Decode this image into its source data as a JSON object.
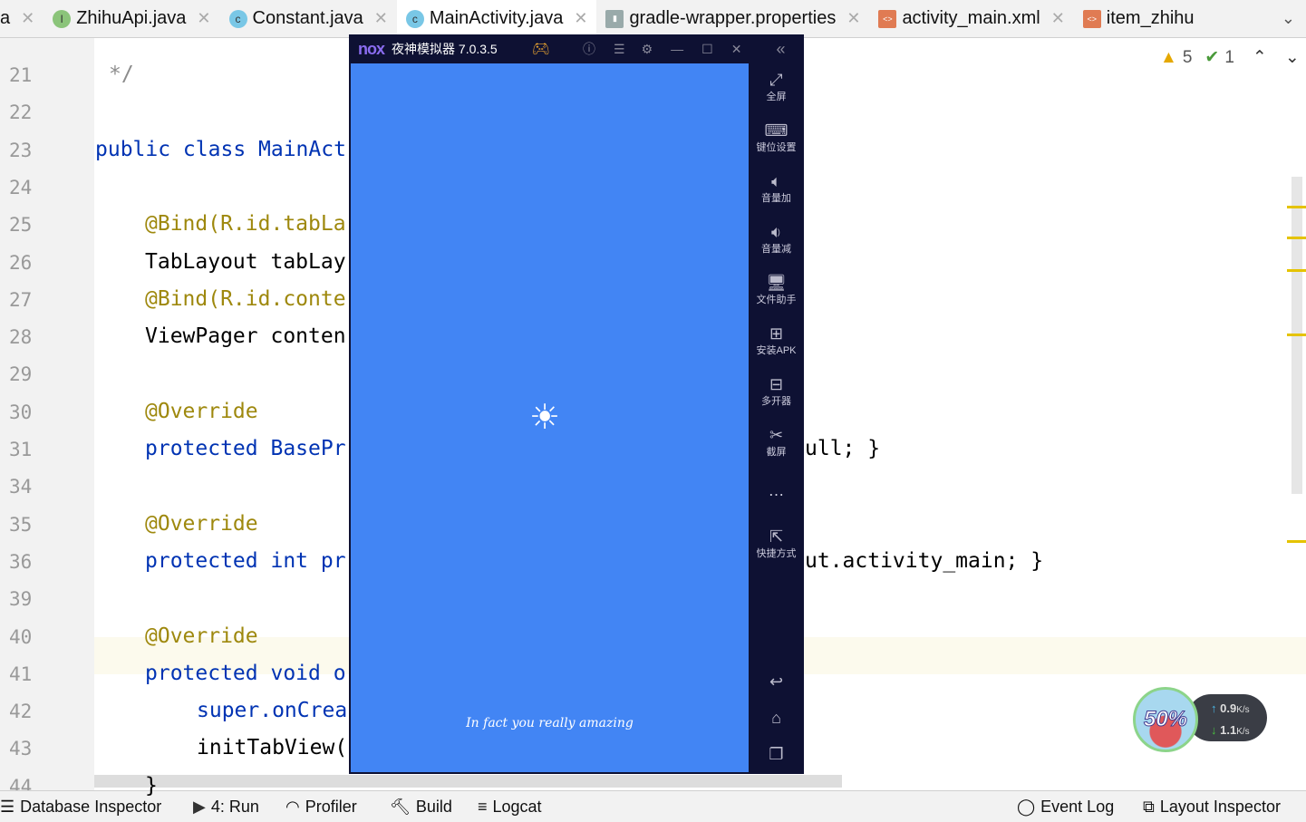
{
  "tabs": [
    {
      "label": "a",
      "icon": "none"
    },
    {
      "label": "ZhihuApi.java",
      "icon": "interface-icon"
    },
    {
      "label": "Constant.java",
      "icon": "class-icon"
    },
    {
      "label": "MainActivity.java",
      "icon": "class-icon",
      "active": true
    },
    {
      "label": "gradle-wrapper.properties",
      "icon": "properties-icon"
    },
    {
      "label": "activity_main.xml",
      "icon": "xml-icon"
    },
    {
      "label": "item_zhihu",
      "icon": "xml-icon"
    }
  ],
  "inspections": {
    "warnings": "5",
    "ok": "1"
  },
  "lines": [
    {
      "n": "21",
      "left": "*/"
    },
    {
      "n": "22",
      "left": ""
    },
    {
      "n": "23",
      "left": "public class MainAct"
    },
    {
      "n": "24",
      "left": ""
    },
    {
      "n": "25",
      "left": "@Bind(R.id.tabLa"
    },
    {
      "n": "26",
      "left": "TabLayout tabLay"
    },
    {
      "n": "27",
      "left": "@Bind(R.id.conte"
    },
    {
      "n": "28",
      "left": "ViewPager conten"
    },
    {
      "n": "29",
      "left": ""
    },
    {
      "n": "30",
      "left": "@Override"
    },
    {
      "n": "31",
      "left": "protected BasePr",
      "right": "ull; }"
    },
    {
      "n": "34",
      "left": ""
    },
    {
      "n": "35",
      "left": "@Override"
    },
    {
      "n": "36",
      "left": "protected int pr",
      "right": "ut.activity_main; }"
    },
    {
      "n": "39",
      "left": ""
    },
    {
      "n": "40",
      "left": "@Override"
    },
    {
      "n": "41",
      "left": "protected void o"
    },
    {
      "n": "42",
      "left": "super.onCrea"
    },
    {
      "n": "43",
      "left": "initTabView("
    },
    {
      "n": "44",
      "left": "}"
    }
  ],
  "emulator": {
    "title": "夜神模拟器 7.0.3.5",
    "logo": "nox",
    "splash_text": "In fact you really amazing",
    "sidebar": [
      "全屏",
      "键位设置",
      "音量加",
      "音量减",
      "文件助手",
      "安装APK",
      "多开器",
      "截屏",
      "…",
      "快捷方式"
    ]
  },
  "speed_widget": {
    "percent": "50%",
    "up": "0.9",
    "down": "1.1",
    "unit": "K/s"
  },
  "bottom_bar": {
    "db": "Database Inspector",
    "run": "4: Run",
    "profiler": "Profiler",
    "build": "Build",
    "logcat": "Logcat",
    "event_log": "Event Log",
    "layout_inspector": "Layout Inspector"
  }
}
